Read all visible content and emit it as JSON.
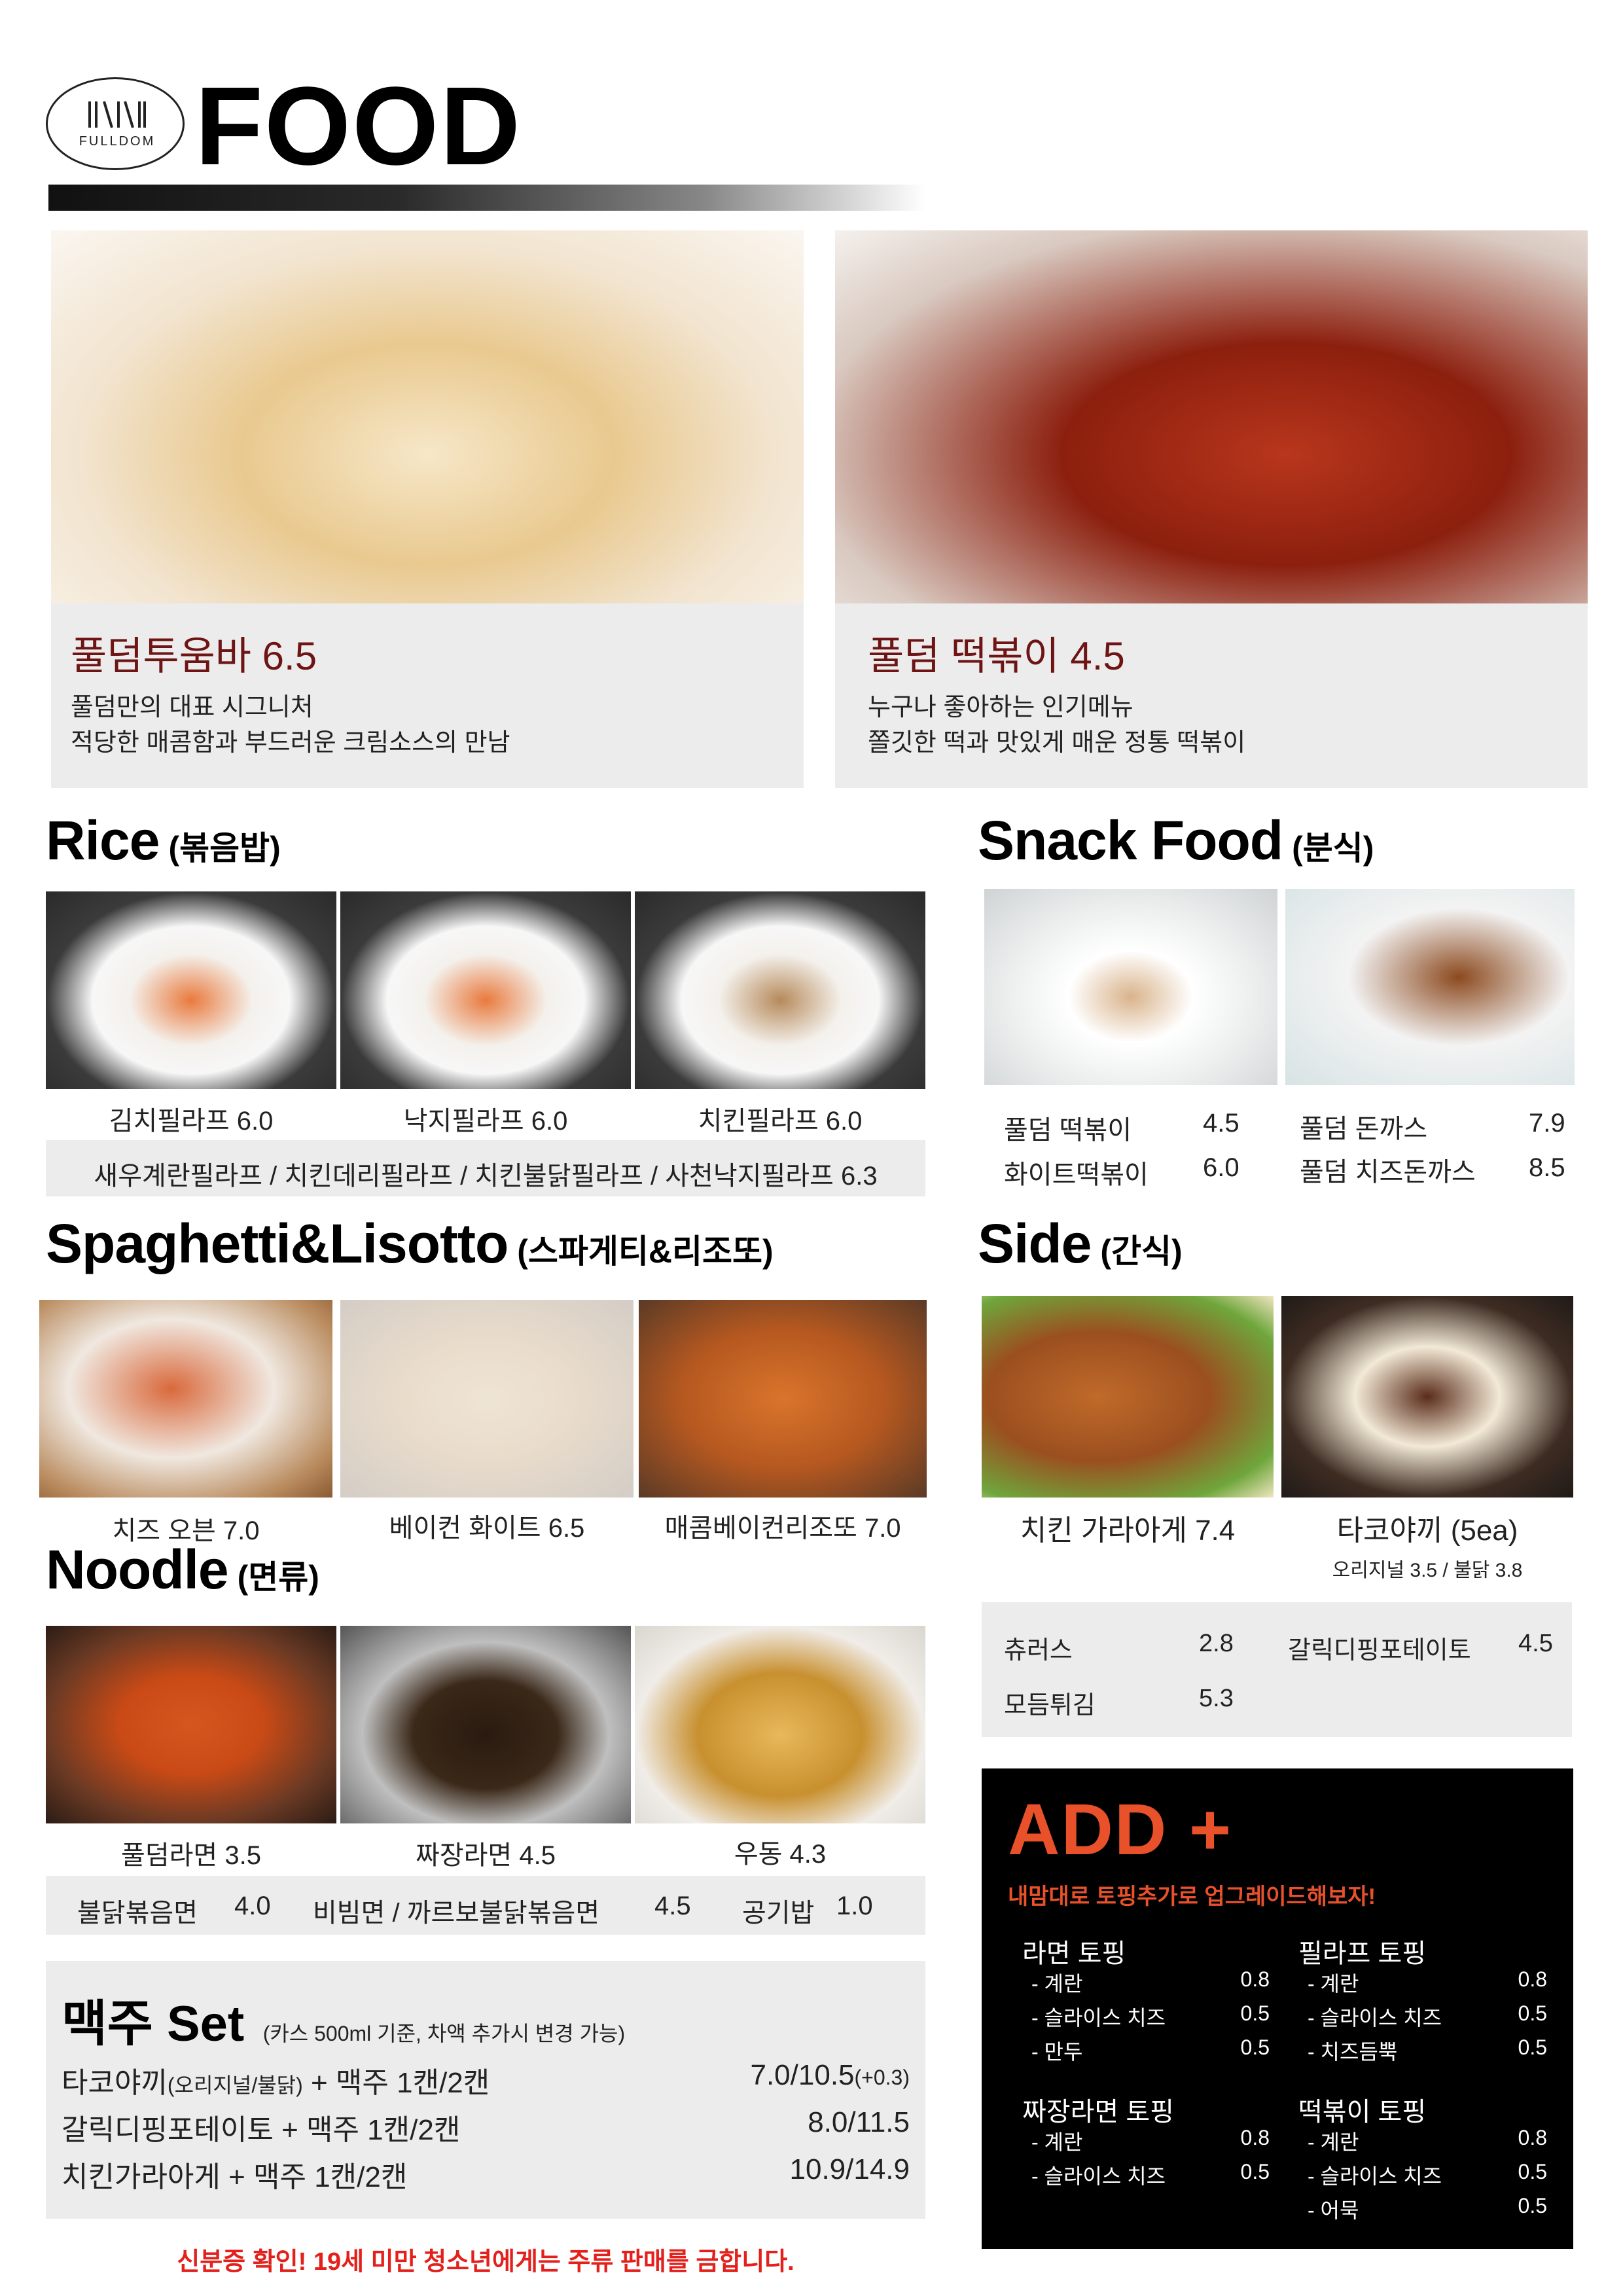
{
  "header": {
    "logo_text": "FULLDOM",
    "title": "FOOD"
  },
  "highlights": [
    {
      "name": "풀덤투움바  6.5",
      "desc1": "풀덤만의 대표 시그니처",
      "desc2": "적당한 매콤함과 부드러운 크림소스의 만남"
    },
    {
      "name": "풀덤 떡볶이 4.5",
      "desc1": "누구나 좋아하는 인기메뉴",
      "desc2": "쫄깃한 떡과 맛있게 매운 정통 떡볶이"
    }
  ],
  "rice": {
    "title": "Rice",
    "subtitle": "(볶음밥)",
    "items": [
      "김치필라프 6.0",
      "낙지필라프 6.0",
      "치킨필라프 6.0"
    ],
    "extra": "새우계란필라프 / 치킨데리필라프 / 치킨불닭필라프 / 사천낙지필라프 6.3"
  },
  "snack": {
    "title": "Snack Food",
    "subtitle": "(분식)",
    "items": [
      {
        "name": "풀덤 떡볶이",
        "price": "4.5"
      },
      {
        "name": "화이트떡볶이",
        "price": "6.0"
      },
      {
        "name": "풀덤 돈까스",
        "price": "7.9"
      },
      {
        "name": "풀덤 치즈돈까스",
        "price": "8.5"
      }
    ]
  },
  "spaghetti": {
    "title": "Spaghetti&Lisotto",
    "subtitle": "(스파게티&리조또)",
    "items": [
      "치즈 오븐 7.0",
      "베이컨 화이트 6.5",
      "매콤베이컨리조또 7.0"
    ]
  },
  "side": {
    "title": "Side",
    "subtitle": "(간식)",
    "items": [
      "치킨 가라아게 7.4",
      "타코야끼 (5ea)"
    ],
    "tako_note": "오리지널 3.5 / 불닭 3.8",
    "extras": [
      {
        "name": "츄러스",
        "price": "2.8"
      },
      {
        "name": "갈릭디핑포테이토",
        "price": "4.5"
      },
      {
        "name": "모듬튀김",
        "price": "5.3"
      }
    ]
  },
  "noodle": {
    "title": "Noodle",
    "subtitle": "(면류)",
    "items": [
      "풀덤라면 3.5",
      "짜장라면 4.5",
      "우동 4.3"
    ],
    "extras": [
      {
        "name": "불닭볶음면",
        "price": "4.0"
      },
      {
        "name": "비빔면 / 까르보불닭볶음면",
        "price": "4.5"
      },
      {
        "name": "공기밥",
        "price": "1.0"
      }
    ]
  },
  "beer_set": {
    "title": "맥주 Set",
    "note": "(카스 500ml 기준, 차액 추가시 변경 가능)",
    "rows": [
      {
        "name_main": "타코야끼",
        "name_sub": "(오리지널/불닭)",
        "name_rest": " + 맥주 1캔/2캔",
        "price": "7.0/10.5",
        "price_note": "(+0.3)"
      },
      {
        "name_main": "갈릭디핑포테이토 + 맥주 1캔/2캔",
        "price": "8.0/11.5"
      },
      {
        "name_main": "치킨가라아게 + 맥주 1캔/2캔",
        "price": "10.9/14.9"
      }
    ]
  },
  "warning": "신분증 확인! 19세 미만 청소년에게는 주류 판매를 금합니다.",
  "add": {
    "title": "ADD +",
    "subtitle": "내맘대로 토핑추가로 업그레이드해보자!",
    "groups": [
      {
        "title": "라면 토핑",
        "items": [
          {
            "name": "- 계란",
            "price": "0.8"
          },
          {
            "name": "- 슬라이스 치즈",
            "price": "0.5"
          },
          {
            "name": "- 만두",
            "price": "0.5"
          }
        ]
      },
      {
        "title": "필라프 토핑",
        "items": [
          {
            "name": "- 계란",
            "price": "0.8"
          },
          {
            "name": "- 슬라이스 치즈",
            "price": "0.5"
          },
          {
            "name": "- 치즈듬뿍",
            "price": "0.5"
          }
        ]
      },
      {
        "title": "짜장라면 토핑",
        "items": [
          {
            "name": "- 계란",
            "price": "0.8"
          },
          {
            "name": "- 슬라이스 치즈",
            "price": "0.5"
          }
        ]
      },
      {
        "title": "떡볶이 토핑",
        "items": [
          {
            "name": "- 계란",
            "price": "0.8"
          },
          {
            "name": "- 슬라이스 치즈",
            "price": "0.5"
          },
          {
            "name": "- 어묵",
            "price": "0.5"
          }
        ]
      }
    ]
  },
  "colors": {
    "accent_red": "#e8512a",
    "title_red": "#6e1414",
    "warning_red": "#e3201b",
    "panel_grey": "#ececec",
    "add_bg": "#000000"
  }
}
